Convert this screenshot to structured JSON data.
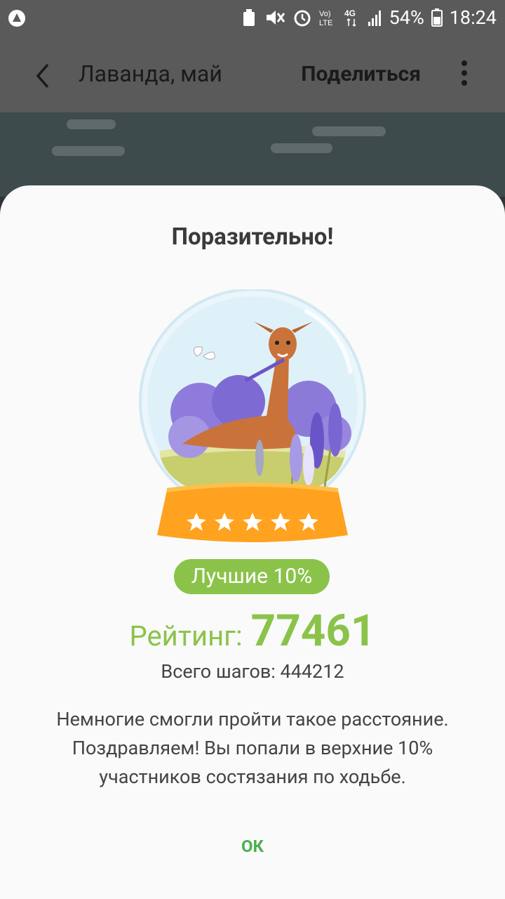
{
  "status_bar": {
    "battery": "54%",
    "time": "18:24",
    "network": "4G",
    "volte": "Vo) LTE"
  },
  "app_bar": {
    "title": "Лаванда, май",
    "share_label": "Поделиться"
  },
  "dialog": {
    "title": "Поразительно!",
    "badge": "Лучшие 10%",
    "rating_label": "Рейтинг:",
    "rating_value": "77461",
    "total_steps": "Всего шагов: 444212",
    "message": "Немногие смогли пройти такое расстояние. Поздравляем! Вы попали в верхние 10% участников состязания по ходьбе.",
    "ok_label": "ОК",
    "stars": 5
  },
  "colors": {
    "accent_green": "#8bc34a",
    "ok_green": "#4caf50",
    "base_orange": "#ff9f1a"
  }
}
